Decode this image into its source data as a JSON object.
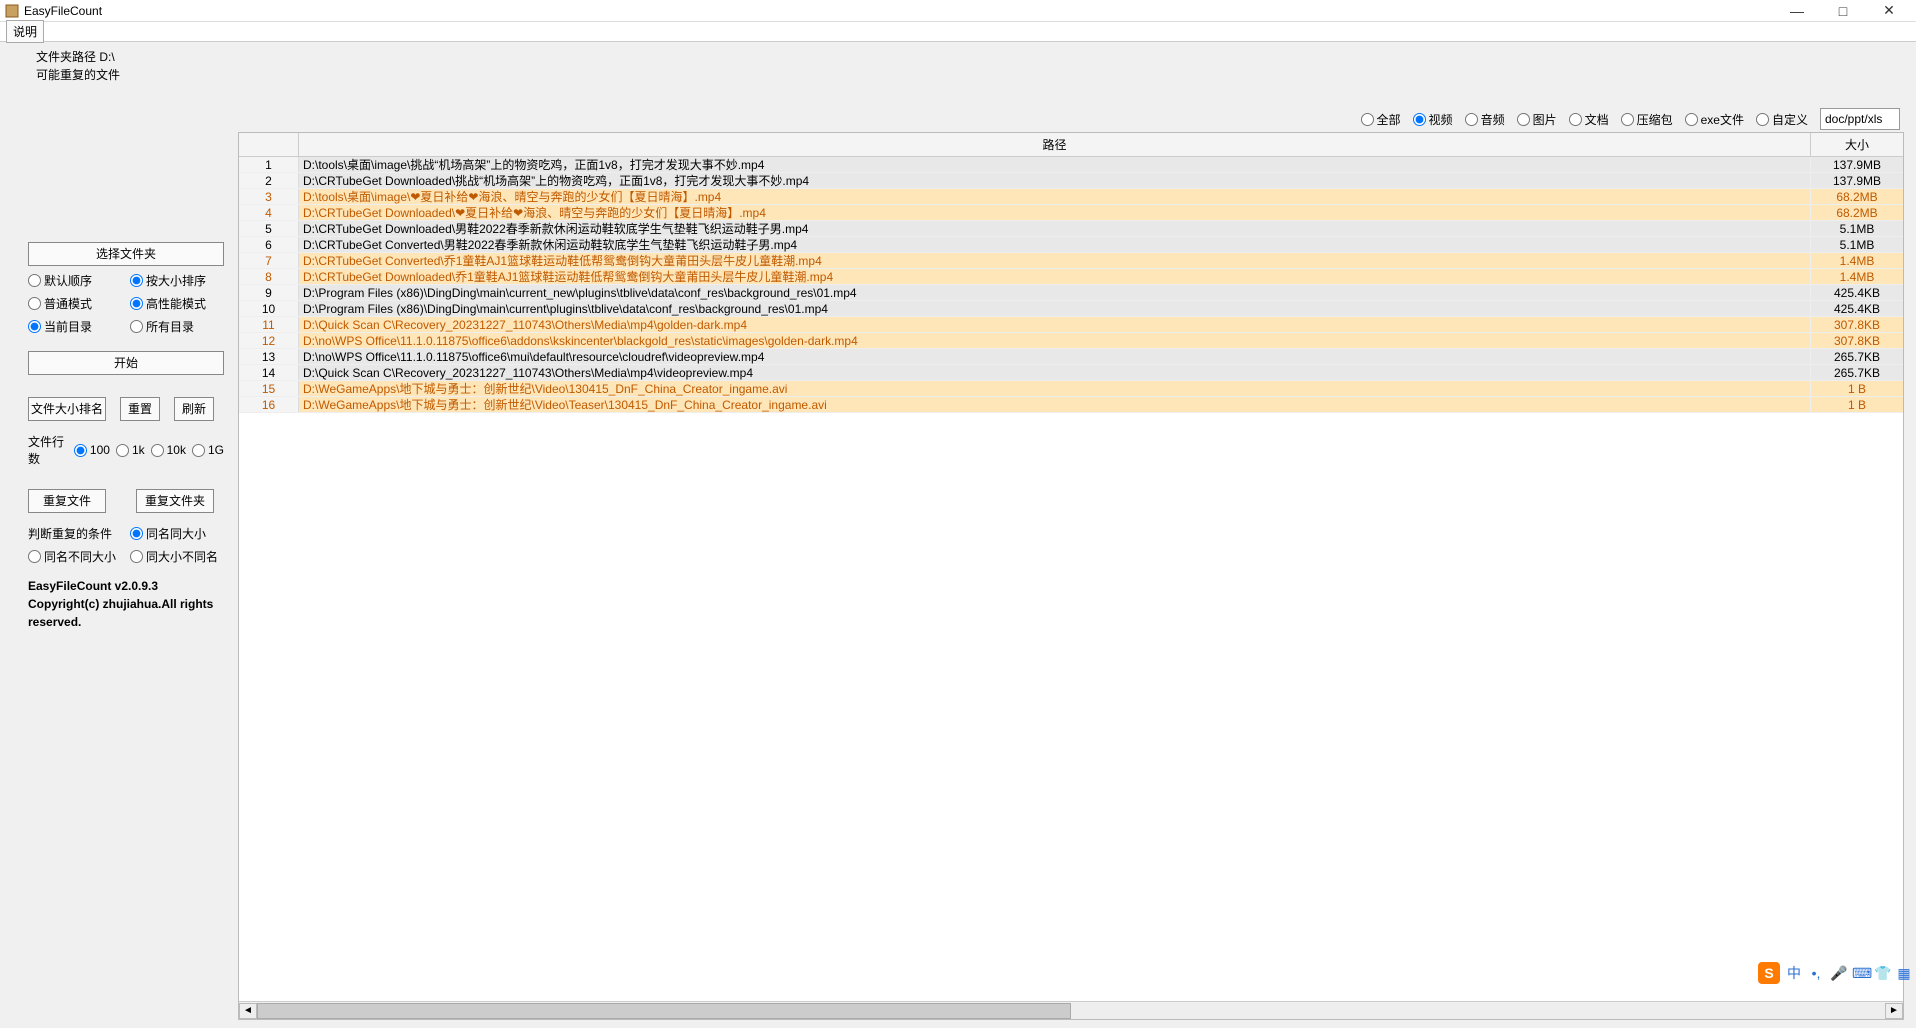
{
  "window": {
    "title": "EasyFileCount",
    "minimize": "—",
    "maximize": "□",
    "close": "✕"
  },
  "menu": {
    "help": "说明"
  },
  "header": {
    "line1": "文件夹路径 D:\\",
    "line2": "可能重复的文件"
  },
  "filters": {
    "all": "全部",
    "video": "视频",
    "audio": "音频",
    "image": "图片",
    "doc": "文档",
    "archive": "压缩包",
    "exe": "exe文件",
    "custom": "自定义",
    "custom_value": "doc/ppt/xls"
  },
  "columns": {
    "path": "路径",
    "size": "大小"
  },
  "rows": [
    {
      "n": "1",
      "path": "D:\\tools\\桌面\\image\\挑战“机场高架”上的物资吃鸡，正面1v8，打完才发现大事不妙.mp4",
      "size": "137.9MB",
      "alt": 0
    },
    {
      "n": "2",
      "path": "D:\\CRTubeGet Downloaded\\挑战“机场高架”上的物资吃鸡，正面1v8，打完才发现大事不妙.mp4",
      "size": "137.9MB",
      "alt": 0
    },
    {
      "n": "3",
      "path": "D:\\tools\\桌面\\image\\❤夏日补给❤海浪、晴空与奔跑的少女们【夏日晴海】.mp4",
      "size": "68.2MB",
      "alt": 1
    },
    {
      "n": "4",
      "path": "D:\\CRTubeGet Downloaded\\❤夏日补给❤海浪、晴空与奔跑的少女们【夏日晴海】.mp4",
      "size": "68.2MB",
      "alt": 1
    },
    {
      "n": "5",
      "path": "D:\\CRTubeGet Downloaded\\男鞋2022春季新款休闲运动鞋软底学生气垫鞋飞织运动鞋子男.mp4",
      "size": "5.1MB",
      "alt": 0
    },
    {
      "n": "6",
      "path": "D:\\CRTubeGet Converted\\男鞋2022春季新款休闲运动鞋软底学生气垫鞋飞织运动鞋子男.mp4",
      "size": "5.1MB",
      "alt": 0
    },
    {
      "n": "7",
      "path": "D:\\CRTubeGet Converted\\乔1童鞋AJ1篮球鞋运动鞋低帮鸳鸯倒钩大童莆田头层牛皮儿童鞋潮.mp4",
      "size": "1.4MB",
      "alt": 1
    },
    {
      "n": "8",
      "path": "D:\\CRTubeGet Downloaded\\乔1童鞋AJ1篮球鞋运动鞋低帮鸳鸯倒钩大童莆田头层牛皮儿童鞋潮.mp4",
      "size": "1.4MB",
      "alt": 1
    },
    {
      "n": "9",
      "path": "D:\\Program Files (x86)\\DingDing\\main\\current_new\\plugins\\tblive\\data\\conf_res\\background_res\\01.mp4",
      "size": "425.4KB",
      "alt": 0
    },
    {
      "n": "10",
      "path": "D:\\Program Files (x86)\\DingDing\\main\\current\\plugins\\tblive\\data\\conf_res\\background_res\\01.mp4",
      "size": "425.4KB",
      "alt": 0
    },
    {
      "n": "11",
      "path": "D:\\Quick Scan C\\Recovery_20231227_110743\\Others\\Media\\mp4\\golden-dark.mp4",
      "size": "307.8KB",
      "alt": 1
    },
    {
      "n": "12",
      "path": "D:\\no\\WPS Office\\11.1.0.11875\\office6\\addons\\kskincenter\\blackgold_res\\static\\images\\golden-dark.mp4",
      "size": "307.8KB",
      "alt": 1
    },
    {
      "n": "13",
      "path": "D:\\no\\WPS Office\\11.1.0.11875\\office6\\mui\\default\\resource\\cloudref\\videopreview.mp4",
      "size": "265.7KB",
      "alt": 0
    },
    {
      "n": "14",
      "path": "D:\\Quick Scan C\\Recovery_20231227_110743\\Others\\Media\\mp4\\videopreview.mp4",
      "size": "265.7KB",
      "alt": 0
    },
    {
      "n": "15",
      "path": "D:\\WeGameApps\\地下城与勇士：创新世纪\\Video\\130415_DnF_China_Creator_ingame.avi",
      "size": "1 B",
      "alt": 1
    },
    {
      "n": "16",
      "path": "D:\\WeGameApps\\地下城与勇士：创新世纪\\Video\\Teaser\\130415_DnF_China_Creator_ingame.avi",
      "size": "1 B",
      "alt": 1
    }
  ],
  "sidebar": {
    "choose_folder": "选择文件夹",
    "sort_default": "默认顺序",
    "sort_size": "按大小排序",
    "mode_normal": "普通模式",
    "mode_perf": "高性能模式",
    "dir_current": "当前目录",
    "dir_all": "所有目录",
    "start": "开始",
    "rank_size": "文件大小排名",
    "reset": "重置",
    "refresh": "刷新",
    "rows_label": "文件行数",
    "r100": "100",
    "r1k": "1k",
    "r10k": "10k",
    "r1g": "1G",
    "dup_files": "重复文件",
    "dup_folders": "重复文件夹",
    "dup_cond": "判断重复的条件",
    "cond_name_size": "同名同大小",
    "cond_name_diff_size": "同名不同大小",
    "cond_size_diff_name": "同大小不同名",
    "version": "EasyFileCount v2.0.9.3",
    "copyright": "Copyright(c) zhujiahua.All rights reserved."
  },
  "ime": {
    "s": "S",
    "zh": "中"
  }
}
